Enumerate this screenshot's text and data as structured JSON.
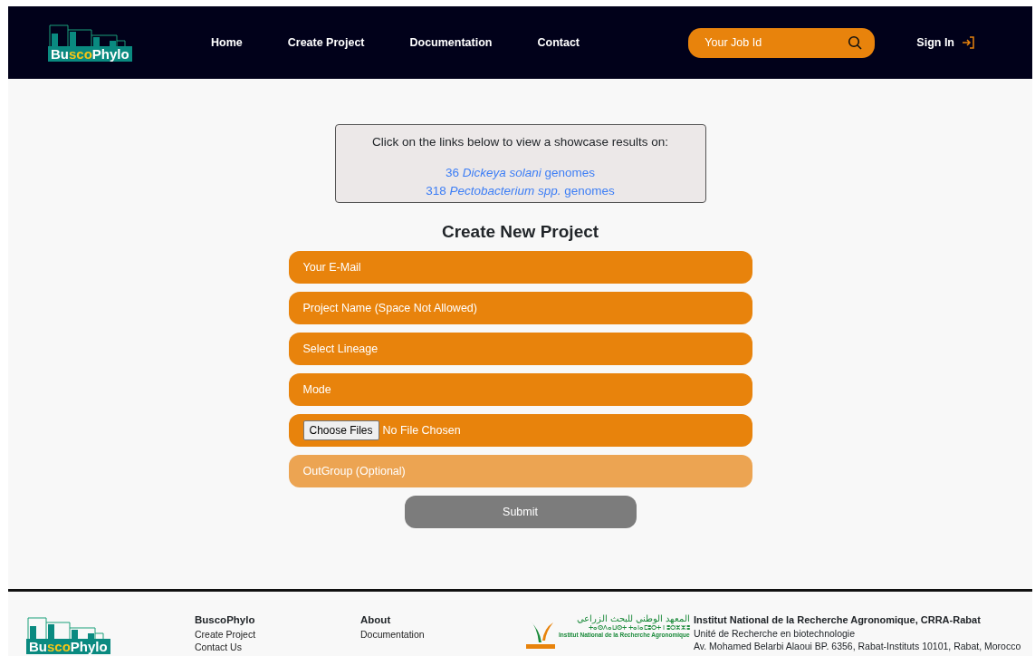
{
  "navbar": {
    "logo": [
      {
        "text": "Bu",
        "highlighted": false
      },
      {
        "text": "sco",
        "highlighted": true
      },
      {
        "text": "Phylo",
        "highlighted": false
      }
    ],
    "links": [
      "Home",
      "Create Project",
      "Documentation",
      "Contact"
    ],
    "search": {
      "placeholder": "Your Job Id"
    },
    "sign_in": "Sign In"
  },
  "showcase": {
    "intro": "Click on the links below to view a showcase results on:",
    "links": [
      "36 *Dickeya solani* genomes",
      "318 *Pectobacterium spp.* genomes"
    ]
  },
  "form": {
    "title": "Create New Project",
    "fields": [
      {
        "kind": "input",
        "placeholder": "Your E-Mail",
        "disabled": false
      },
      {
        "kind": "input",
        "placeholder": "Project Name (Space Not Allowed)",
        "disabled": false
      },
      {
        "kind": "select",
        "value": "Select Lineage",
        "disabled": false
      },
      {
        "kind": "select",
        "value": "Mode",
        "disabled": false
      },
      {
        "kind": "file",
        "button": "Choose Files",
        "status": "No File Chosen",
        "disabled": false
      },
      {
        "kind": "input",
        "placeholder": "OutGroup (Optional)",
        "disabled": true
      }
    ],
    "submit": "Submit"
  },
  "footer": {
    "logo": [
      {
        "text": "Bu",
        "highlighted": false
      },
      {
        "text": "sco",
        "highlighted": true
      },
      {
        "text": "Phylo",
        "highlighted": false
      }
    ],
    "columns": [
      {
        "title": "BuscoPhylo",
        "links": [
          "Create Project",
          "Contact Us"
        ]
      },
      {
        "title": "About",
        "links": [
          "Documentation"
        ]
      }
    ],
    "institute_logo": {
      "arabic": "المعهد الوطني للبحث الزراعي",
      "tifinagh": "ⵜⴰⵙⴷⴰⵡⵙⵜ ⵜⴰⵏⴰⵎⵓⵔⵜ ⵏ ⵓⵔⵣⵣⵓ",
      "french": "Institut National de la Recherche Agronomique"
    },
    "address": [
      "Institut National de la Recherche Agronomique, CRRA-Rabat",
      "Unité de Recherche en biotechnologie",
      "Av. Mohamed Belarbi Alaoui BP. 6356, Rabat-Instituts 10101, Rabat, Morocco"
    ]
  }
}
